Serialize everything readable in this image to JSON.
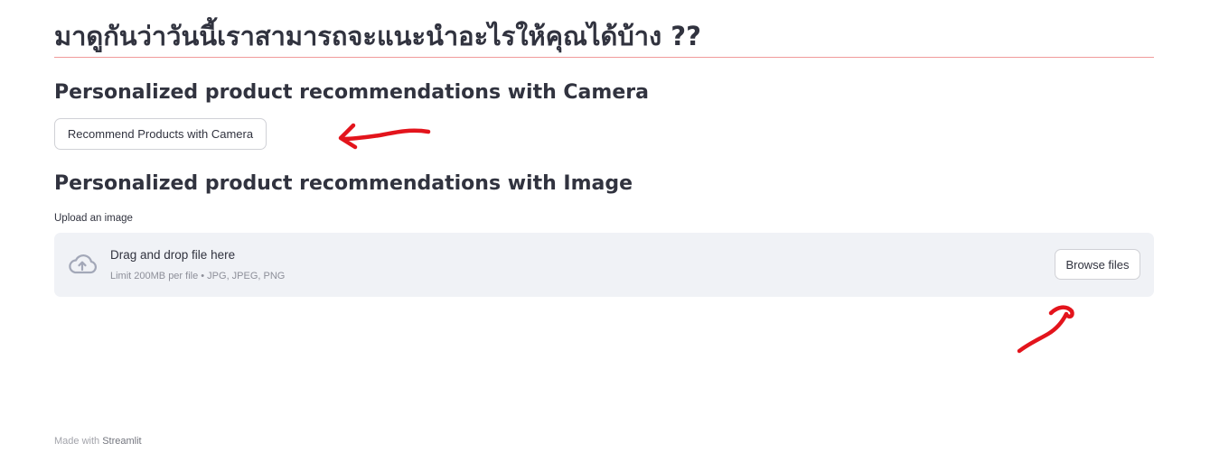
{
  "page": {
    "title": "มาดูกันว่าวันนี้เราสามารถจะแนะนำอะไรให้คุณได้บ้าง ??"
  },
  "camera_section": {
    "heading": "Personalized product recommendations with Camera",
    "button_label": "Recommend Products with Camera"
  },
  "image_section": {
    "heading": "Personalized product recommendations with Image",
    "uploader": {
      "label": "Upload an image",
      "drop_text": "Drag and drop file here",
      "limit_text": "Limit 200MB per file • JPG, JPEG, PNG",
      "browse_label": "Browse files",
      "icon": "cloud-upload-icon"
    }
  },
  "footer": {
    "prefix": "Made with ",
    "brand": "Streamlit"
  },
  "colors": {
    "divider": "#f09a9a",
    "dropzone_bg": "#f0f2f6",
    "annotation_arrow": "#e3141c",
    "text": "#31333f"
  }
}
